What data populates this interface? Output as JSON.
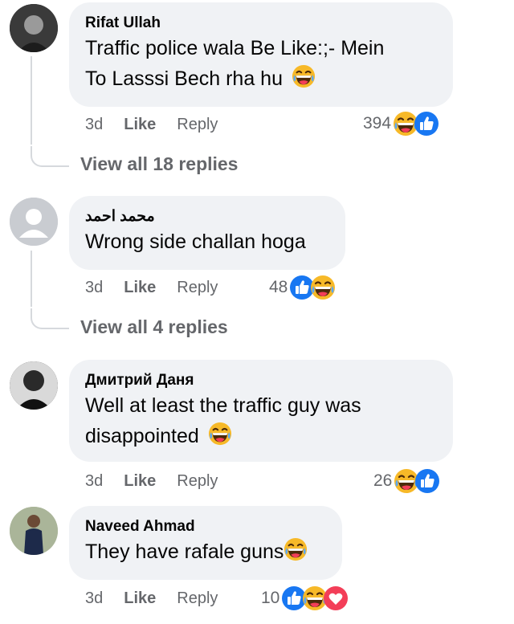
{
  "comments": [
    {
      "author": "Rifat Ullah",
      "text_line1": "Traffic police wala Be Like:;- Mein",
      "text_line2": "To Lasssi Bech rha hu",
      "time": "3d",
      "like": "Like",
      "reply": "Reply",
      "reaction_count": "394",
      "reactions": [
        "haha",
        "like"
      ],
      "view_replies": "View all 18 replies"
    },
    {
      "author": "محمد احمد",
      "text_line1": "Wrong side challan hoga",
      "time": "3d",
      "like": "Like",
      "reply": "Reply",
      "reaction_count": "48",
      "reactions": [
        "like",
        "haha"
      ],
      "view_replies": "View all 4 replies"
    },
    {
      "author": "Дмитрий Даня",
      "text_line1": "Well at least the traffic guy was",
      "text_line2": "disappointed",
      "time": "3d",
      "like": "Like",
      "reply": "Reply",
      "reaction_count": "26",
      "reactions": [
        "haha",
        "like"
      ]
    },
    {
      "author": "Naveed Ahmad",
      "text_line1": "They have rafale guns",
      "time": "3d",
      "like": "Like",
      "reply": "Reply",
      "reaction_count": "10",
      "reactions": [
        "like",
        "haha",
        "love"
      ]
    }
  ],
  "colors": {
    "bubble": "#f0f2f5",
    "meta_text": "#65676b",
    "like_blue": "#1877f2",
    "haha_yellow": "#f7b928",
    "love_red": "#f33e58"
  }
}
